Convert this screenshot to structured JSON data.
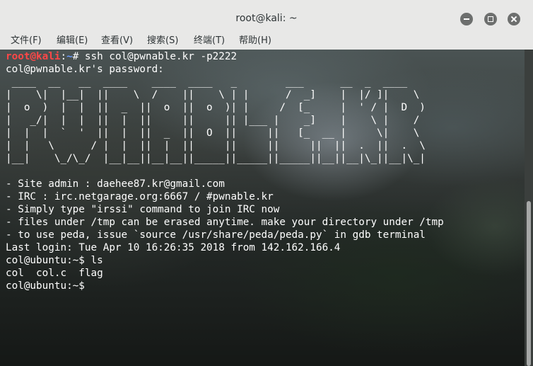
{
  "window": {
    "title": "root@kali: ~",
    "controls": {
      "minimize_icon": "window-minimize-icon",
      "maximize_icon": "window-maximize-icon",
      "close_icon": "window-close-icon"
    }
  },
  "menubar": {
    "items": [
      {
        "label": "文件(F)"
      },
      {
        "label": "编辑(E)"
      },
      {
        "label": "查看(V)"
      },
      {
        "label": "搜索(S)"
      },
      {
        "label": "终端(T)"
      },
      {
        "label": "帮助(H)"
      }
    ]
  },
  "terminal": {
    "prompt_line": {
      "user": "root",
      "at": "@",
      "host": "kali",
      "sep": ":",
      "path": "~",
      "suffix": "# ",
      "command": "ssh col@pwnable.kr -p2222"
    },
    "lines": [
      "col@pwnable.kr's password:",
      " ____  __   __  ____    ____  ____   _        ___      __  _  ____",
      "|    \\|  |__|  ||    \\  /    ||    \\ | |      /  _]    |  |/ ]|    \\",
      "|  o  )  |  |  ||  _  ||  o  ||  o  )| |     /  [_     |  ' / |  D  )",
      "|   _/|  |  |  ||  |  ||     ||     || |___ |    _]    |    \\ |    /",
      "|  |  |  `  '  ||  |  ||  _  ||  O  ||     ||   [_  __ |     \\|    \\",
      "|  |   \\      / |  |  ||  |  ||     ||     ||     ||  ||  .  ||  .  \\",
      "|__|    \\_/\\_/  |__|__||__|__||_____||_____||_____||__||__|\\_||__|\\_|",
      "",
      "- Site admin : daehee87.kr@gmail.com",
      "- IRC : irc.netgarage.org:6667 / #pwnable.kr",
      "- Simply type \"irssi\" command to join IRC now",
      "- files under /tmp can be erased anytime. make your directory under /tmp",
      "- to use peda, issue `source /usr/share/peda/peda.py` in gdb terminal",
      "Last login: Tue Apr 10 16:26:35 2018 from 142.162.166.4",
      "col@ubuntu:~$ ls",
      "col  col.c  flag",
      "col@ubuntu:~$"
    ]
  }
}
